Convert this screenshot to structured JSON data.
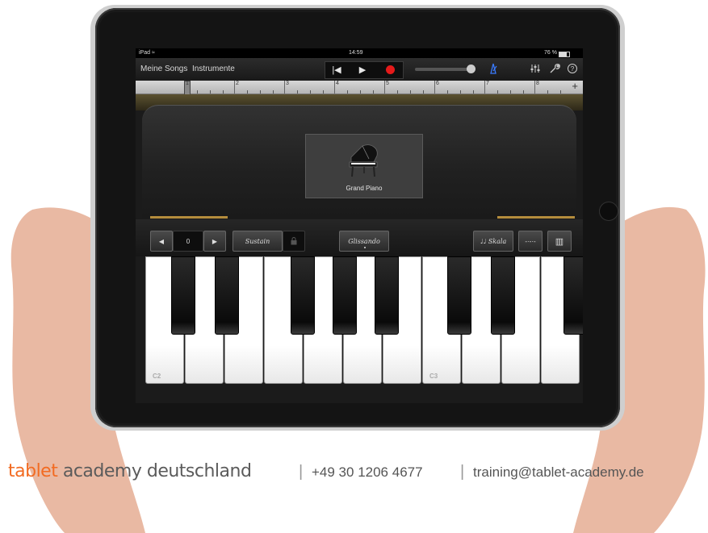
{
  "status": {
    "device": "iPad",
    "time": "14:59",
    "battery": "76 %"
  },
  "toolbar": {
    "my_songs": "Meine Songs",
    "instruments": "Instrumente",
    "rewind_glyph": "|◀",
    "play_glyph": "▶",
    "colors": {
      "record": "#e51a1a",
      "accent_gold": "#b48c3c"
    }
  },
  "ruler": {
    "bars": [
      "1",
      "2",
      "3",
      "4",
      "5",
      "6",
      "7",
      "8"
    ],
    "add_glyph": "+"
  },
  "instrument": {
    "name": "Grand Piano",
    "icon": "grand-piano-icon"
  },
  "controls": {
    "octave_value": "0",
    "sustain_label": "Sustain",
    "glissando_label": "Glissando",
    "scale_label": "♩♩ Skala",
    "arpeggio_glyph": "-·-·-",
    "keyboard_glyph": "▥"
  },
  "keyboard": {
    "c2_label": "C2",
    "c3_label": "C3"
  },
  "footer": {
    "brand_part1": "tablet",
    "brand_part2": " academy deutschland",
    "separator": "|",
    "phone": "+49 30 1206 4677",
    "email": "training@tablet-academy.de"
  }
}
